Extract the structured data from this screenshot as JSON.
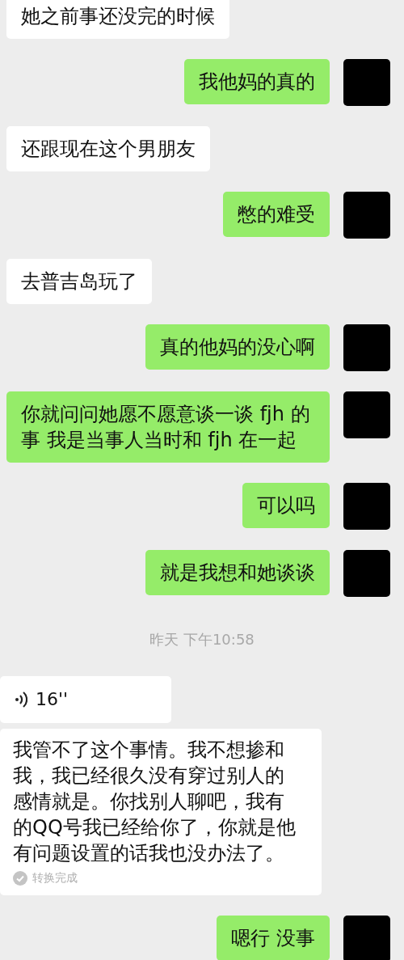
{
  "messages": [
    {
      "kind": "text",
      "outgoing": false,
      "text": "她之前事还没完的时候"
    },
    {
      "kind": "text",
      "outgoing": true,
      "text": "我他妈的真的"
    },
    {
      "kind": "text",
      "outgoing": false,
      "text": "还跟现在这个男朋友"
    },
    {
      "kind": "text",
      "outgoing": true,
      "text": "憋的难受"
    },
    {
      "kind": "text",
      "outgoing": false,
      "text": "去普吉岛玩了"
    },
    {
      "kind": "text",
      "outgoing": true,
      "text": "真的他妈的没心啊"
    },
    {
      "kind": "text",
      "outgoing": true,
      "text": "你就问问她愿不愿意谈一谈 fjh 的事 我是当事人当时和 fjh 在一起"
    },
    {
      "kind": "text",
      "outgoing": true,
      "text": "可以吗"
    },
    {
      "kind": "text",
      "outgoing": true,
      "text": "就是我想和她谈谈"
    },
    {
      "kind": "time",
      "text": "昨天 下午10:58"
    },
    {
      "kind": "voice",
      "outgoing": false,
      "duration": "16''",
      "transcript": "我管不了这个事情。我不想掺和我，我已经很久没有穿过别人的感情就是。你找别人聊吧，我有的QQ号我已经给你了，你就是他有问题设置的话我也没办法了。",
      "status": "转换完成"
    },
    {
      "kind": "text",
      "outgoing": true,
      "text": "嗯行 没事"
    }
  ]
}
